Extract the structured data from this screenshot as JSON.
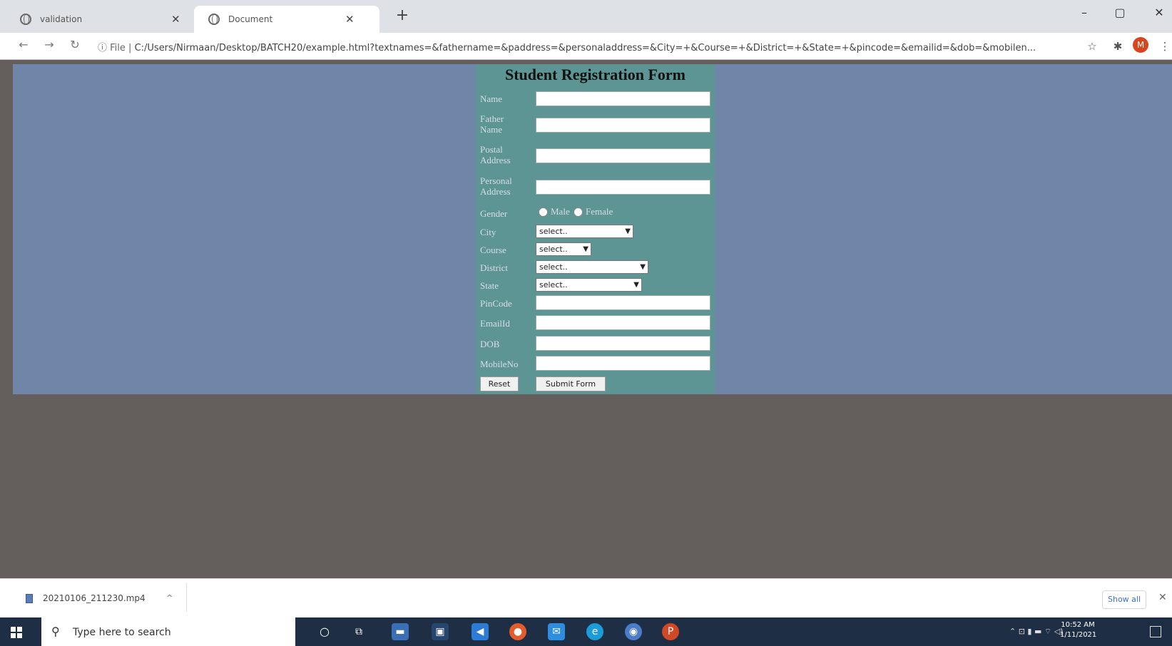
{
  "browser": {
    "tabs": [
      {
        "title": "validation",
        "active": false
      },
      {
        "title": "Document",
        "active": true
      }
    ],
    "window_controls": {
      "minimize": "–",
      "restore": "▢",
      "close": "✕"
    },
    "url_prefix": "File",
    "url": "C:/Users/Nirmaan/Desktop/BATCH20/example.html?textnames=&fathername=&paddress=&personaladdress=&City=+&Course=+&District=+&State=+&pincode=&emailid=&dob=&mobilen...",
    "avatar_letter": "M"
  },
  "form": {
    "title": "Student Registration Form",
    "labels": {
      "name": "Name",
      "father_name": "Father Name",
      "postal_address": "Postal Address",
      "personal_address": "Personal Address",
      "gender": "Gender",
      "city": "City",
      "course": "Course",
      "district": "District",
      "state": "State",
      "pincode": "PinCode",
      "email": "EmailId",
      "dob": "DOB",
      "mobile": "MobileNo"
    },
    "gender_options": [
      "Male",
      "Female"
    ],
    "selects": {
      "city": "select..",
      "course": "select..",
      "district": "select..",
      "state": "select.."
    },
    "buttons": {
      "reset": "Reset",
      "submit": "Submit Form"
    }
  },
  "downloads": {
    "file_name": "20210106_211230.mp4",
    "show_all": "Show all"
  },
  "taskbar": {
    "search_placeholder": "Type here to search",
    "time": "10:52 AM",
    "date": "1/11/2021"
  },
  "colors": {
    "page_background": "#645e5d",
    "form_band": "#7086a8",
    "form_panel": "#5c9593",
    "taskbar": "#1e2f45"
  }
}
